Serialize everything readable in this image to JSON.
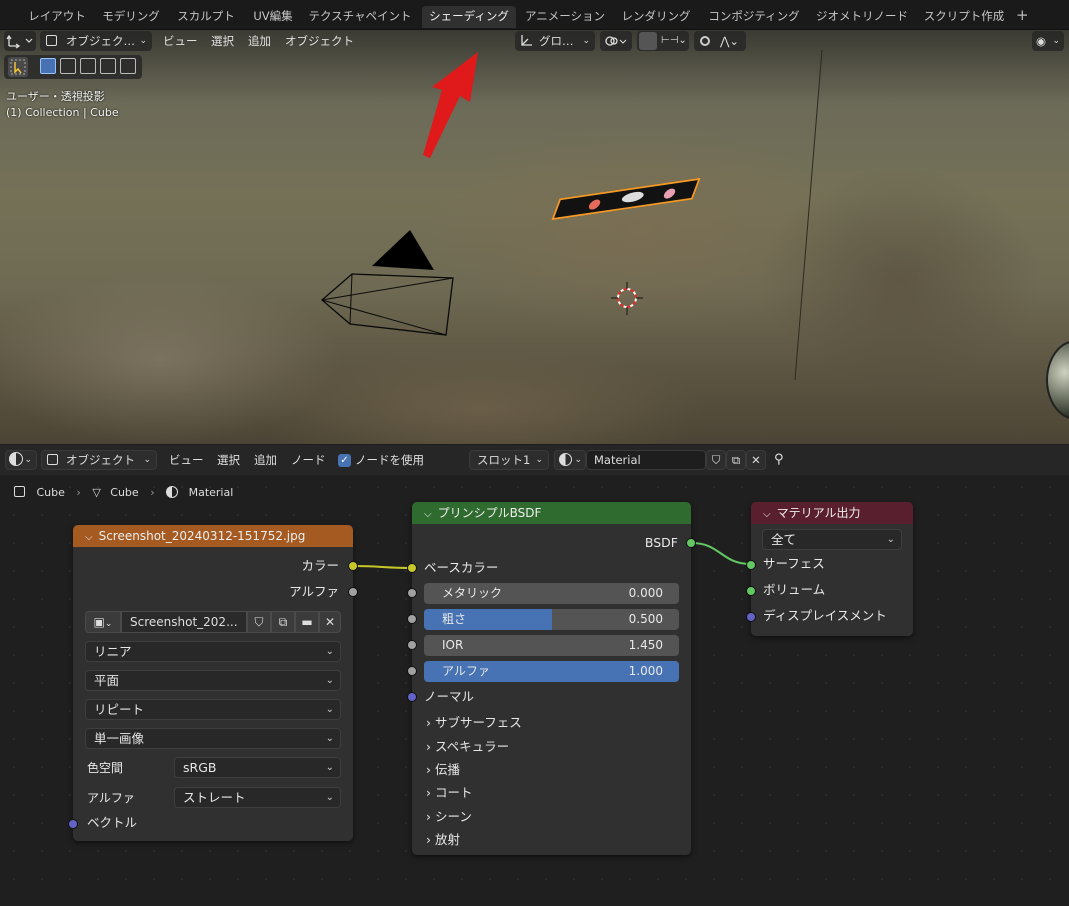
{
  "workspace_tabs": [
    "レイアウト",
    "モデリング",
    "スカルプト",
    "UV編集",
    "テクスチャペイント",
    "シェーディング",
    "アニメーション",
    "レンダリング",
    "コンポジティング",
    "ジオメトリノード",
    "スクリプト作成"
  ],
  "active_tab": "シェーディング",
  "viewport": {
    "mode": "オブジェク…",
    "menus": [
      "ビュー",
      "選択",
      "追加",
      "オブジェクト"
    ],
    "transform_orientation": "グロ…",
    "view_label": "ユーザー・透視投影",
    "collection_label": "(1) Collection | Cube"
  },
  "node_editor": {
    "mode": "オブジェクト",
    "menus": [
      "ビュー",
      "選択",
      "追加",
      "ノード"
    ],
    "use_nodes_label": "ノードを使用",
    "slot": "スロット1",
    "material_name": "Material",
    "breadcrumb": [
      "Cube",
      "Cube",
      "Material"
    ]
  },
  "image_node": {
    "title": "Screenshot_20240312-151752.jpg",
    "outputs": [
      "カラー",
      "アルファ"
    ],
    "image_name": "Screenshot_202...",
    "interpolation": "リニア",
    "projection": "平面",
    "extension": "リピート",
    "source": "単一画像",
    "colorspace_label": "色空間",
    "colorspace": "sRGB",
    "alpha_label": "アルファ",
    "alpha_mode": "ストレート",
    "input": "ベクトル"
  },
  "bsdf_node": {
    "title": "プリンシプルBSDF",
    "output": "BSDF",
    "base_color": "ベースカラー",
    "fields": [
      {
        "label": "メタリック",
        "value": "0.000",
        "fill": 0.0
      },
      {
        "label": "粗さ",
        "value": "0.500",
        "fill": 0.5
      },
      {
        "label": "IOR",
        "value": "1.450",
        "fill": 0.0
      },
      {
        "label": "アルファ",
        "value": "1.000",
        "fill": 1.0
      }
    ],
    "normal": "ノーマル",
    "panels": [
      "サブサーフェス",
      "スペキュラー",
      "伝播",
      "コート",
      "シーン",
      "放射"
    ]
  },
  "output_node": {
    "title": "マテリアル出力",
    "target": "全て",
    "inputs": [
      "サーフェス",
      "ボリューム",
      "ディスプレイスメント"
    ]
  },
  "colors": {
    "image_header": "#a45a20",
    "bsdf_header": "#2f6b2f",
    "output_header": "#5a1f2e",
    "active_arrow": "#e0191b",
    "selection_outline": "#f19a2a"
  }
}
